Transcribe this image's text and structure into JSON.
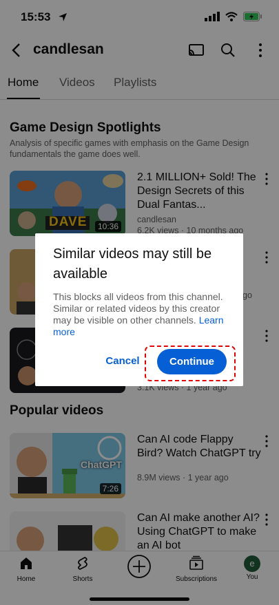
{
  "status": {
    "time": "15:53"
  },
  "header": {
    "channel_name": "candlesan"
  },
  "tabs": [
    {
      "label": "Home"
    },
    {
      "label": "Videos"
    },
    {
      "label": "Playlists"
    }
  ],
  "section1": {
    "title": "Game Design Spotlights",
    "description": "Analysis of specific games with emphasis on the Game Design fundamentals the game does well.",
    "videos": [
      {
        "title": "2.1 MILLION+ Sold! The Design Secrets of this Dual Fantas...",
        "channel": "candlesan",
        "meta": "6.2K views · 10 months ago",
        "duration": "10:36",
        "thumb_text": "DAVE"
      },
      {
        "meta_partial": "go"
      },
      {
        "meta": "3.1K views · 1 year ago"
      }
    ]
  },
  "section2": {
    "title": "Popular videos",
    "videos": [
      {
        "title": "Can AI code Flappy Bird? Watch ChatGPT try",
        "meta": "8.9M views · 1 year ago",
        "duration": "7:26",
        "thumb_text": "ChatGPT"
      },
      {
        "title": "Can AI make another AI? Using ChatGPT to make an AI bot"
      }
    ]
  },
  "dialog": {
    "title": "Similar videos may still be available",
    "body": "This blocks all videos from this channel. Similar or related videos by this creator may be visible on other channels.",
    "learn_more": "Learn more",
    "cancel": "Cancel",
    "continue": "Continue"
  },
  "bottom_nav": [
    {
      "label": "Home"
    },
    {
      "label": "Shorts"
    },
    {
      "label": ""
    },
    {
      "label": "Subscriptions"
    },
    {
      "label": "You",
      "avatar_letter": "e"
    }
  ],
  "colors": {
    "accent": "#065fd4",
    "highlight": "#e00000"
  }
}
